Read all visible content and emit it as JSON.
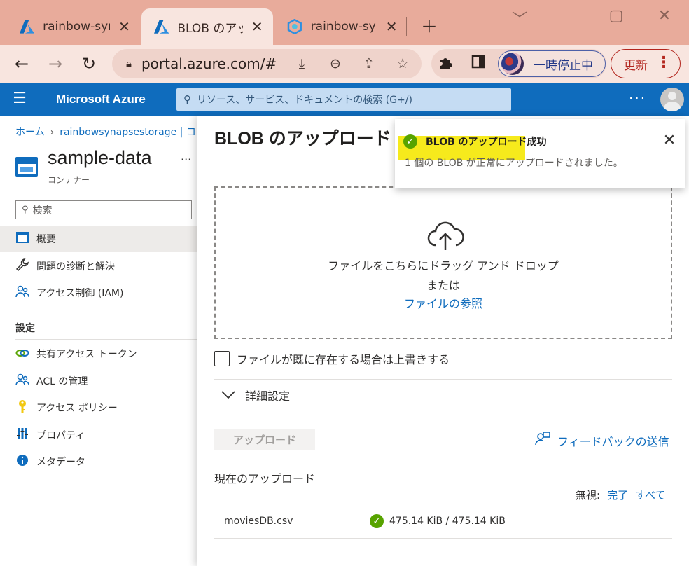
{
  "browser": {
    "tabs": [
      {
        "title": "rainbow-synapsestorage - Microsoft Azure",
        "close": "✕"
      },
      {
        "title": "BLOB のアップロード - Microsoft Azure",
        "close": "✕"
      },
      {
        "title": "rainbow-synapse - Synapse Studio",
        "close": "✕"
      }
    ],
    "new_tab": "+",
    "window_controls": {
      "minimize": "﹀",
      "maximize": "▢",
      "close": "✕"
    },
    "url": "portal.azure.com/#...",
    "profile_label": "一時停止中",
    "update_label": "更新",
    "accent": "#b3261e"
  },
  "azure": {
    "brand": "Microsoft Azure",
    "search_placeholder": "リソース、サービス、ドキュメントの検索 (G+/)",
    "header_more": "···",
    "header_color": "#0f6cbd"
  },
  "left": {
    "breadcrumb": {
      "home": "ホーム",
      "chev": "›",
      "storage": "rainbowsynapsestorage | コンテナー"
    },
    "resource_title": "sample-data",
    "resource_more": "···",
    "resource_subtitle": "コンテナー",
    "search_placeholder": "検索",
    "nav_items": [
      {
        "label": "概要",
        "icon": "overview-icon"
      },
      {
        "label": "問題の診断と解決",
        "icon": "wrench-icon"
      },
      {
        "label": "アクセス制御 (IAM)",
        "icon": "people-icon"
      }
    ],
    "section_label": "設定",
    "settings_items": [
      {
        "label": "共有アクセス トークン",
        "icon": "link-icon"
      },
      {
        "label": "ACL の管理",
        "icon": "people-icon"
      },
      {
        "label": "アクセス ポリシー",
        "icon": "key-icon"
      },
      {
        "label": "プロパティ",
        "icon": "properties-icon"
      },
      {
        "label": "メタデータ",
        "icon": "info-icon"
      }
    ]
  },
  "blade": {
    "title": "BLOB のアップロード",
    "dropzone_line1": "ファイルをこちらにドラッグ アンド ドロップ",
    "dropzone_line2": "または",
    "browse_link": "ファイルの参照",
    "overwrite_label": "ファイルが既に存在する場合は上書きする",
    "advanced_label": "詳細設定",
    "upload_button": "アップロード",
    "feedback_label": "フィードバックの送信",
    "current_uploads_label": "現在のアップロード",
    "ignore_label": "無視:",
    "ignore_done": "完了",
    "ignore_all": "すべて",
    "files": [
      {
        "name": "moviesDB.csv",
        "progress": "475.14 KiB / 475.14 KiB",
        "status": "success"
      }
    ]
  },
  "toast": {
    "title": "BLOB のアップロード成功",
    "message": "1 個の BLOB が正常にアップロードされました。",
    "close": "✕",
    "highlight_color": "#f6ea1c"
  }
}
